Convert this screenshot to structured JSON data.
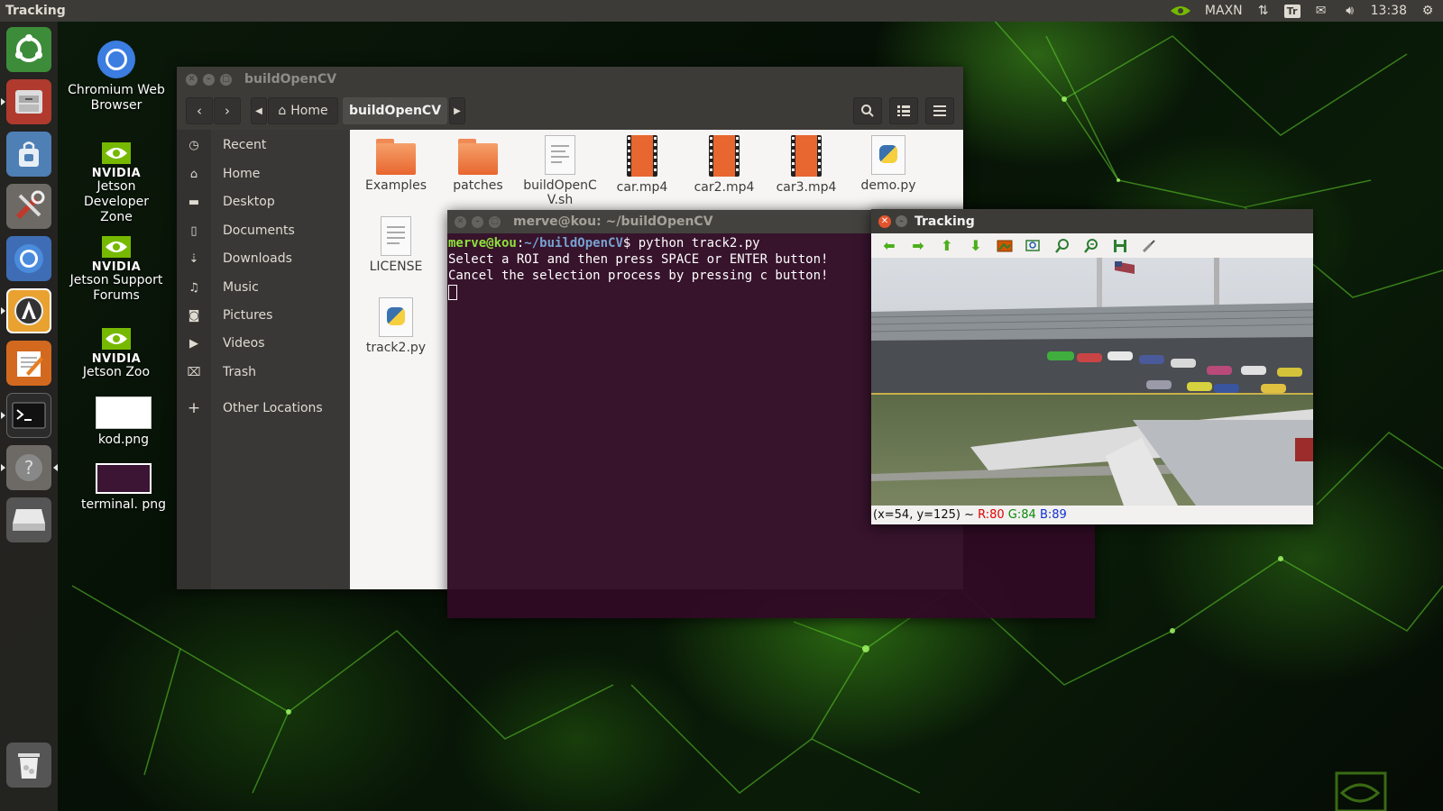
{
  "top_panel": {
    "app_title": "Tracking",
    "keyboard": "Tr",
    "power_mode": "MAXN",
    "clock": "13:38"
  },
  "desktop_icons": [
    {
      "label": "Chromium Web Browser"
    },
    {
      "brand": "NVIDIA",
      "label": "Jetson Developer Zone"
    },
    {
      "brand": "NVIDIA",
      "label": "Jetson Support Forums"
    },
    {
      "brand": "NVIDIA",
      "label": "Jetson Zoo"
    },
    {
      "label": "kod.png"
    },
    {
      "label": "terminal. png"
    }
  ],
  "file_manager": {
    "title": "buildOpenCV",
    "breadcrumb_home": "Home",
    "breadcrumb_current": "buildOpenCV",
    "sidebar": [
      {
        "label": "Recent",
        "icon": "clock-icon"
      },
      {
        "label": "Home",
        "icon": "home-icon"
      },
      {
        "label": "Desktop",
        "icon": "folder-icon"
      },
      {
        "label": "Documents",
        "icon": "document-icon"
      },
      {
        "label": "Downloads",
        "icon": "download-icon"
      },
      {
        "label": "Music",
        "icon": "music-icon"
      },
      {
        "label": "Pictures",
        "icon": "camera-icon"
      },
      {
        "label": "Videos",
        "icon": "video-icon"
      },
      {
        "label": "Trash",
        "icon": "trash-icon"
      },
      {
        "label": "Other Locations",
        "icon": "plus-icon"
      }
    ],
    "files": [
      {
        "name": "Examples",
        "type": "folder"
      },
      {
        "name": "patches",
        "type": "folder"
      },
      {
        "name": "buildOpenC V.sh",
        "type": "script"
      },
      {
        "name": "car.mp4",
        "type": "video"
      },
      {
        "name": "car2.mp4",
        "type": "video"
      },
      {
        "name": "car3.mp4",
        "type": "video"
      },
      {
        "name": "demo.py",
        "type": "python"
      },
      {
        "name": "LICENSE",
        "type": "text"
      },
      {
        "name": "track2.py",
        "type": "python"
      }
    ]
  },
  "terminal": {
    "title": "merve@kou: ~/buildOpenCV",
    "prompt_user": "merve@kou",
    "prompt_sep": ":",
    "prompt_path": "~/buildOpenCV",
    "prompt_end": "$ ",
    "command": "python track2.py",
    "output": [
      "Select a ROI and then press SPACE or ENTER button!",
      "Cancel the selection process by pressing c button!"
    ]
  },
  "tracking": {
    "title": "Tracking",
    "status_coords": "(x=54, y=125) ~ ",
    "status_r": "R:80",
    "status_g": "G:84",
    "status_b": "B:89"
  },
  "colors": {
    "panel": "#3c3b37",
    "terminal_bg": "#300a24",
    "folder_orange": "#e8662f",
    "nvidia_green": "#76b900"
  }
}
